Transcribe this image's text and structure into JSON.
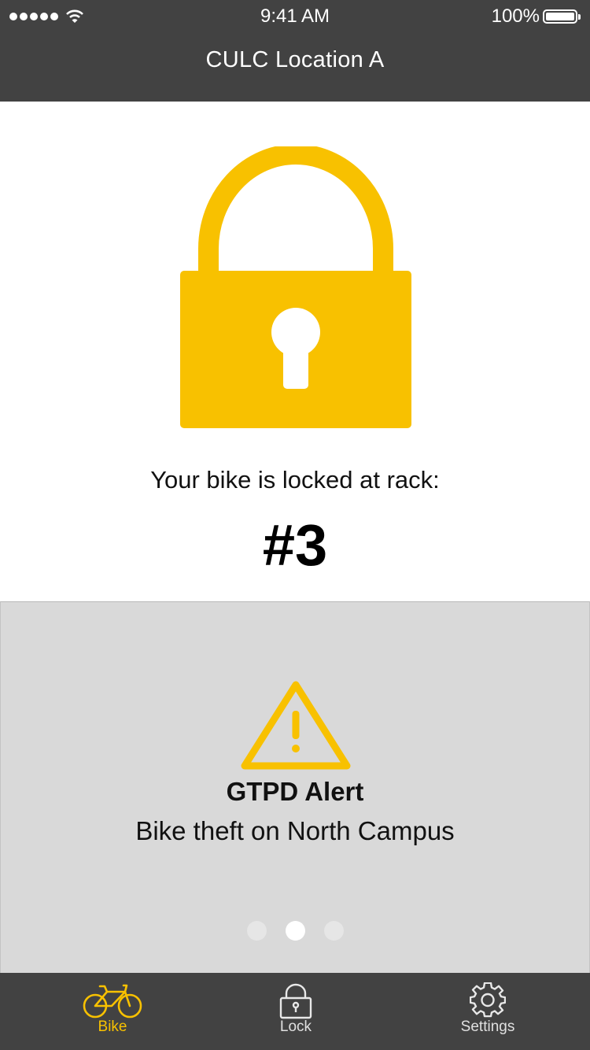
{
  "status_bar": {
    "time": "9:41 AM",
    "battery": "100%"
  },
  "header": {
    "title": "CULC Location A"
  },
  "lock_status": {
    "message": "Your bike is locked at rack:",
    "rack": "#3"
  },
  "alert": {
    "title": "GTPD Alert",
    "body": "Bike theft on North Campus",
    "pages": 3,
    "active_page": 2
  },
  "tabs": [
    {
      "label": "Bike",
      "icon": "bike-icon",
      "active": true
    },
    {
      "label": "Lock",
      "icon": "lock-icon",
      "active": false
    },
    {
      "label": "Settings",
      "icon": "gear-icon",
      "active": false
    }
  ],
  "colors": {
    "accent": "#F8C100",
    "bar": "#424242",
    "panel": "#D9D9D9"
  }
}
